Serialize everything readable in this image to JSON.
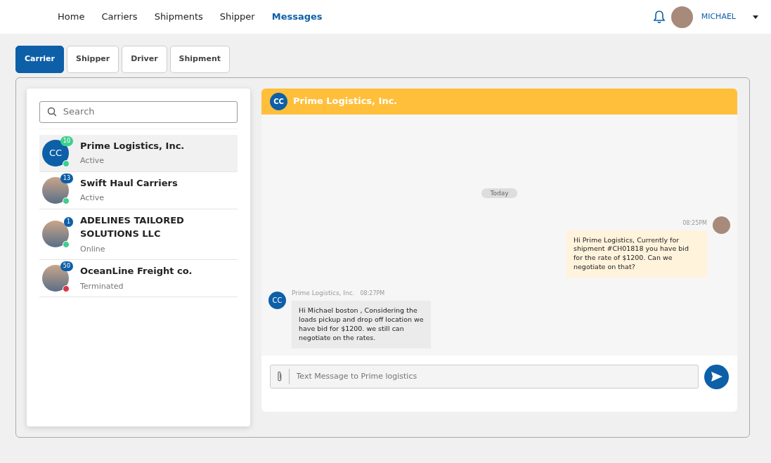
{
  "nav": {
    "items": [
      {
        "label": "Home",
        "selected": false
      },
      {
        "label": "Carriers",
        "selected": false
      },
      {
        "label": "Shipments",
        "selected": false
      },
      {
        "label": "Shipper",
        "selected": false
      },
      {
        "label": "Messages",
        "selected": true
      }
    ],
    "user": "MICHAEL"
  },
  "tabs": [
    {
      "label": "Carrier",
      "selected": true
    },
    {
      "label": "Shipper",
      "selected": false
    },
    {
      "label": "Driver",
      "selected": false
    },
    {
      "label": "Shipment",
      "selected": false
    }
  ],
  "search": {
    "placeholder": "Search"
  },
  "contacts": [
    {
      "kind": "initials",
      "initials": "CC",
      "name": "Prime Logistics, Inc.",
      "status": "Active",
      "count": "10",
      "color": "#3ecf8e",
      "selected": true
    },
    {
      "kind": "photo",
      "name": "Swift Haul Carriers",
      "status": "Active",
      "count": "13",
      "color": "#3ecf8e",
      "selected": false
    },
    {
      "kind": "photo",
      "name": "ADELINES TAILORED SOLUTIONS LLC",
      "status": "Online",
      "count": "1",
      "color": "#3ecf8e",
      "selected": false
    },
    {
      "kind": "photo",
      "name": "OceanLine Freight co.",
      "status": "Terminated",
      "count": "50",
      "color": "#dc3545",
      "selected": false
    }
  ],
  "chat": {
    "initials": "CC",
    "title": "Prime Logistics, Inc.",
    "day": "Today",
    "messages": [
      {
        "kind": "sent",
        "time": "08:25PM",
        "text": "Hi Prime Logistics, Currently for shipment #CH01818 you have bid for the rate of $1200. Can we negotiate on that?"
      },
      {
        "kind": "received",
        "initials": "CC",
        "sender": "Prime Logistics, Inc.",
        "time": "08:27PM",
        "text": "Hi Michael boston , Considering the loads pickup and drop off location we have bid for $1200. we still can negotiate on the rates."
      }
    ],
    "input": {
      "placeholder": "Text Message to Prime logistics"
    }
  }
}
